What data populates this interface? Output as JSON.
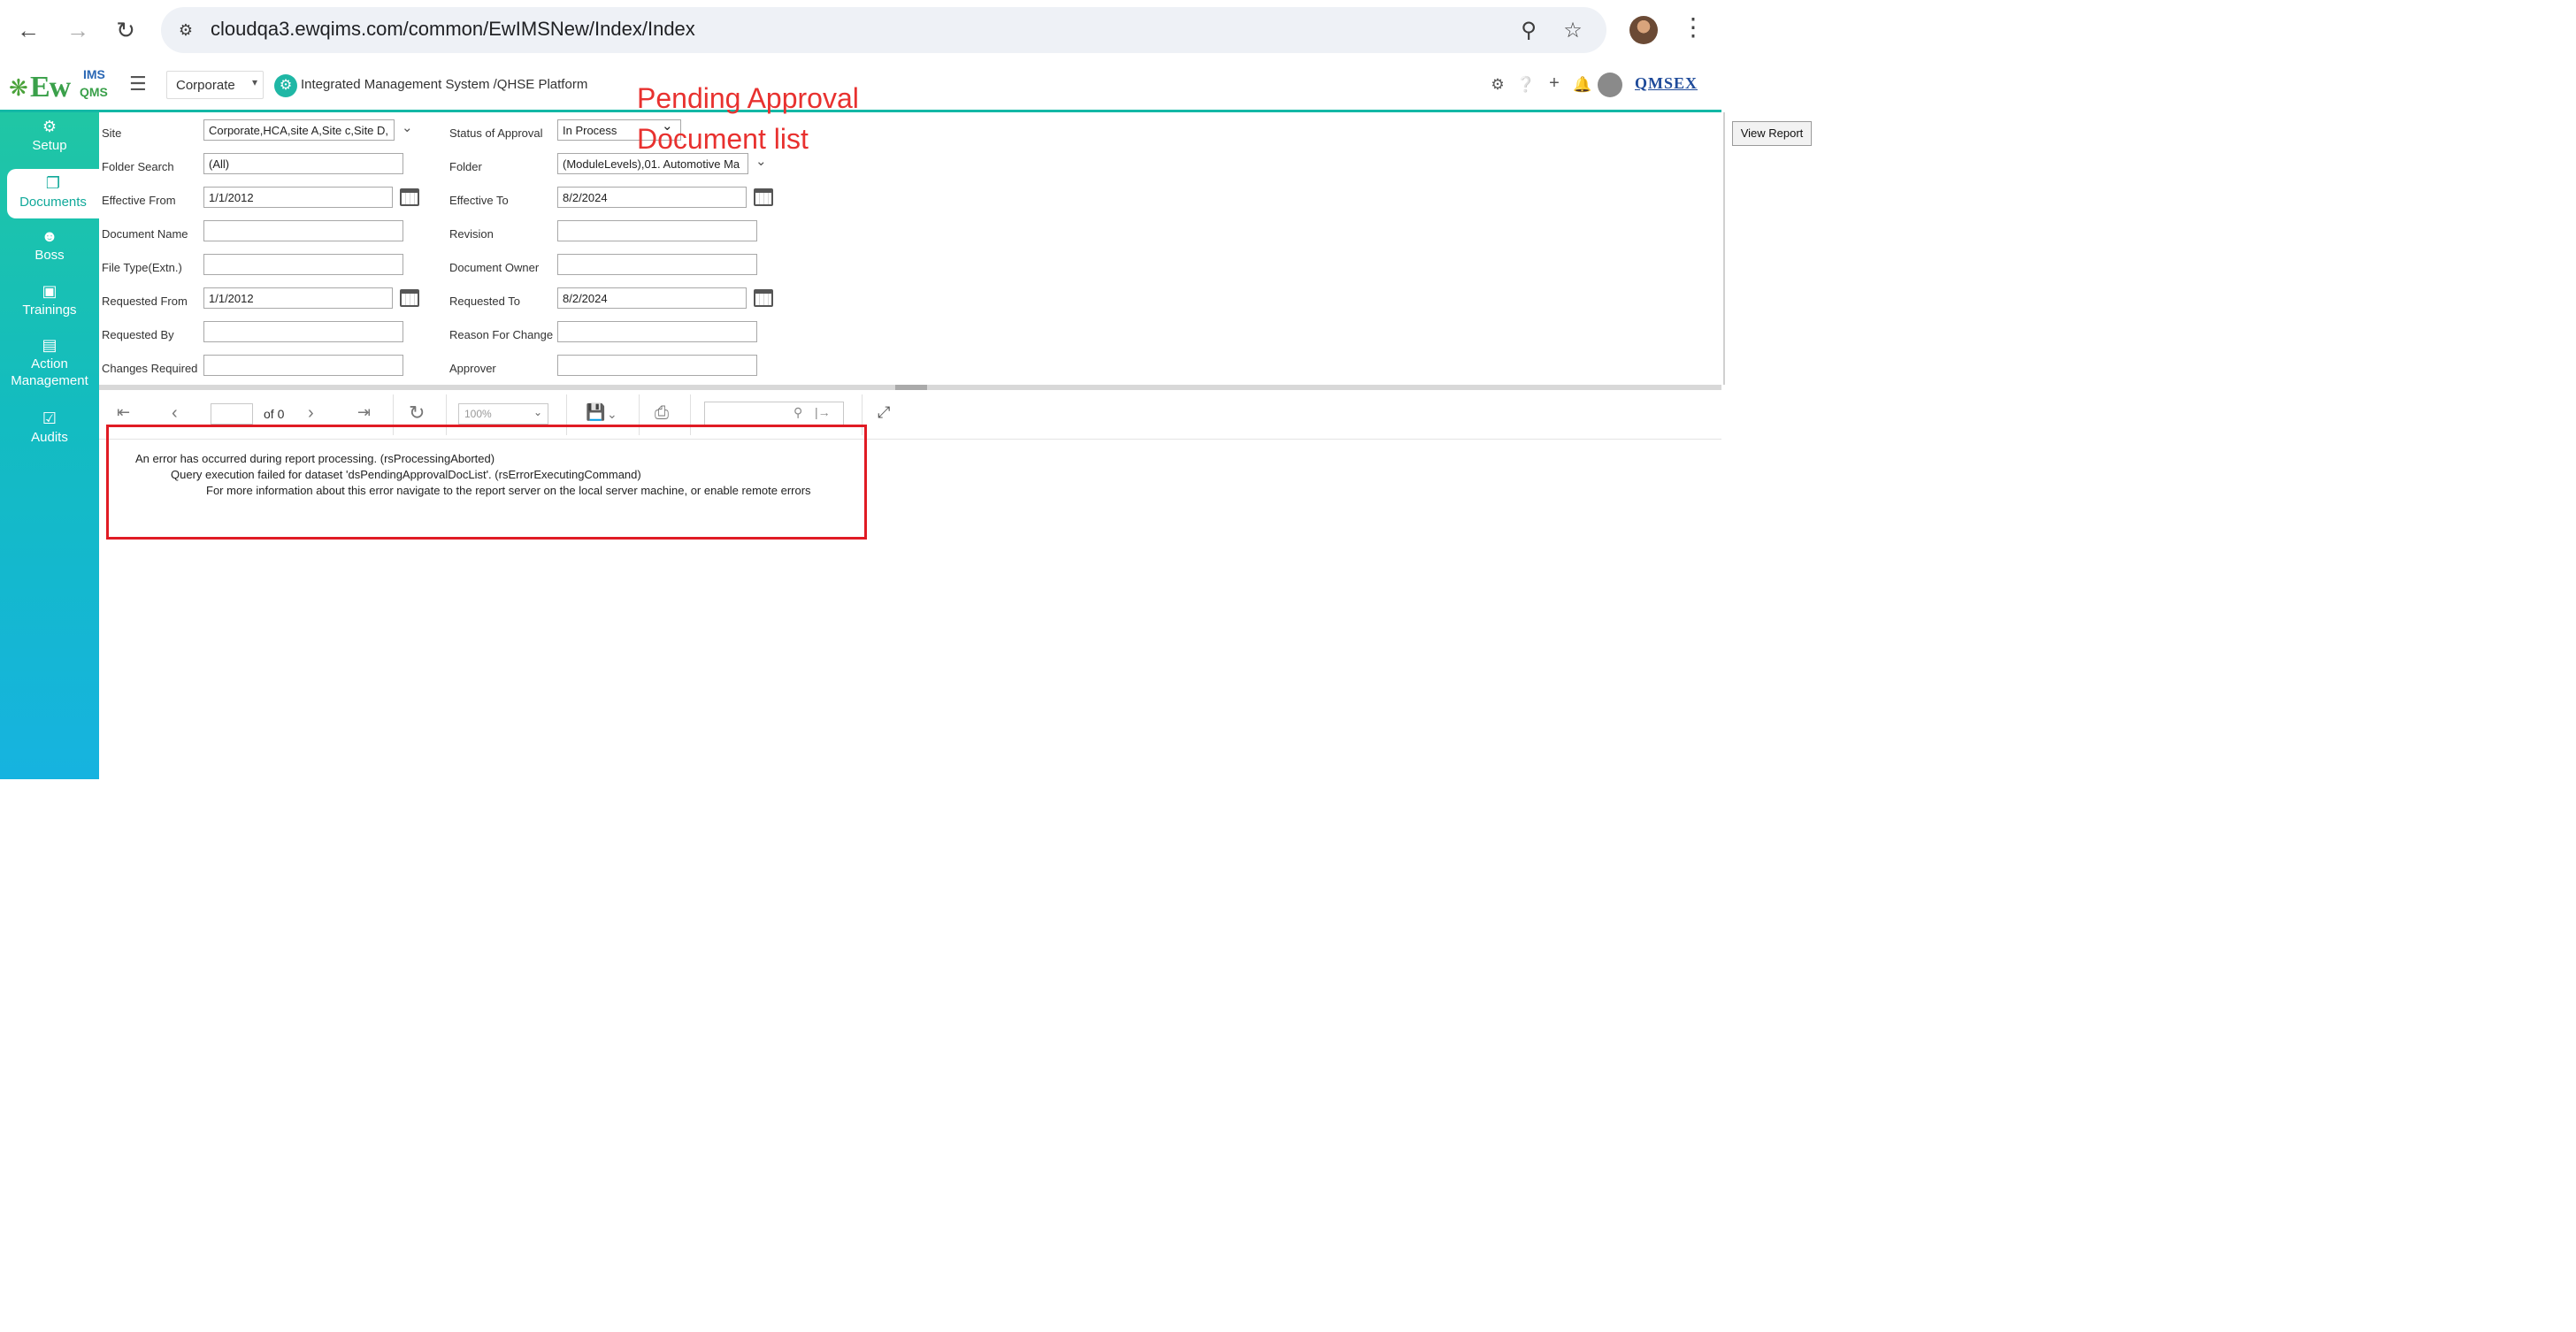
{
  "browser": {
    "url": "cloudqa3.ewqims.com/common/EwIMSNew/Index/Index"
  },
  "header": {
    "logo": {
      "ew": "Ew",
      "ims": "IMS",
      "qms": "QMS"
    },
    "org_select": "Corporate",
    "platform_title": "Integrated Management System /QHSE Platform",
    "brand_logo_text": "QMSEX"
  },
  "sidebar": {
    "items": [
      {
        "label": "Setup",
        "icon": "gears-icon"
      },
      {
        "label": "Documents",
        "icon": "documents-icon",
        "active": true
      },
      {
        "label": "Boss",
        "icon": "person-icon"
      },
      {
        "label": "Trainings",
        "icon": "training-icon"
      },
      {
        "label": "Action Management",
        "icon": "clipboard-icon"
      },
      {
        "label": "Audits",
        "icon": "audit-icon"
      }
    ]
  },
  "annotation": {
    "line1": "Pending Approval",
    "line2": "Document list"
  },
  "params": {
    "site_label": "Site",
    "site_value": "Corporate,HCA,site A,Site c,Site D,",
    "status_label": "Status of Approval",
    "status_value": "In Process",
    "folder_search_label": "Folder Search",
    "folder_search_value": "(All)",
    "folder_label": "Folder",
    "folder_value": "(ModuleLevels),01. Automotive Ma",
    "effective_from_label": "Effective From",
    "effective_from_value": "1/1/2012",
    "effective_to_label": "Effective To",
    "effective_to_value": "8/2/2024",
    "document_name_label": "Document Name",
    "revision_label": "Revision",
    "file_type_label": "File Type(Extn.)",
    "document_owner_label": "Document Owner",
    "requested_from_label": "Requested From",
    "requested_from_value": "1/1/2012",
    "requested_to_label": "Requested To",
    "requested_to_value": "8/2/2024",
    "requested_by_label": "Requested By",
    "reason_label": "Reason For Change",
    "changes_required_label": "Changes Required",
    "approver_label": "Approver",
    "view_report": "View Report"
  },
  "toolbar": {
    "page_of": "of 0",
    "zoom": "100%"
  },
  "error": {
    "line1": "An error has occurred during report processing. (rsProcessingAborted)",
    "line2": "Query execution failed for dataset 'dsPendingApprovalDocList'. (rsErrorExecutingCommand)",
    "line3": "For more information about this error navigate to the report server on the local server machine, or enable remote errors"
  },
  "colors": {
    "accent": "#13b8a6",
    "annotation": "#e8312f",
    "error_frame": "#e01b24"
  }
}
